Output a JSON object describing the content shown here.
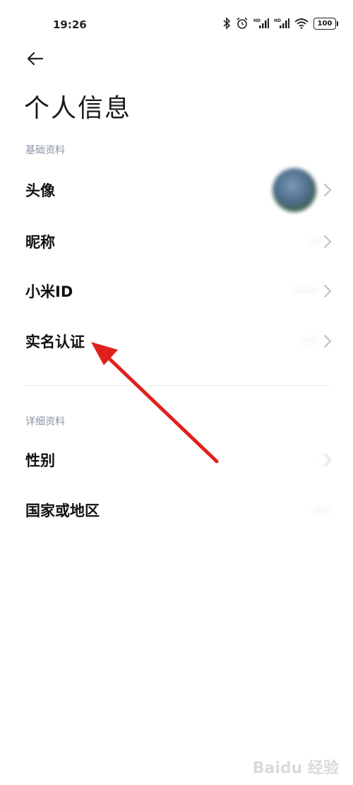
{
  "status_bar": {
    "time": "19:26",
    "battery": "100",
    "icons": [
      "bluetooth-icon",
      "alarm-icon",
      "hd-signal-icon",
      "hd-signal-icon",
      "wifi-icon",
      "battery-icon"
    ]
  },
  "header": {
    "back_icon": "back-arrow-icon",
    "title": "个人信息"
  },
  "basic_section": {
    "label": "基础资料",
    "items": [
      {
        "label": "头像",
        "value": "",
        "type": "avatar"
      },
      {
        "label": "昵称",
        "value": "···"
      },
      {
        "label": "小米ID",
        "value": "········"
      },
      {
        "label": "实名认证",
        "value": "·····"
      }
    ]
  },
  "detail_section": {
    "label": "详细资料",
    "items": [
      {
        "label": "性别",
        "value": "·"
      },
      {
        "label": "国家或地区",
        "value": "·····"
      }
    ]
  },
  "annotation": {
    "color": "#e0201b"
  },
  "watermark": "Baidu 经验"
}
